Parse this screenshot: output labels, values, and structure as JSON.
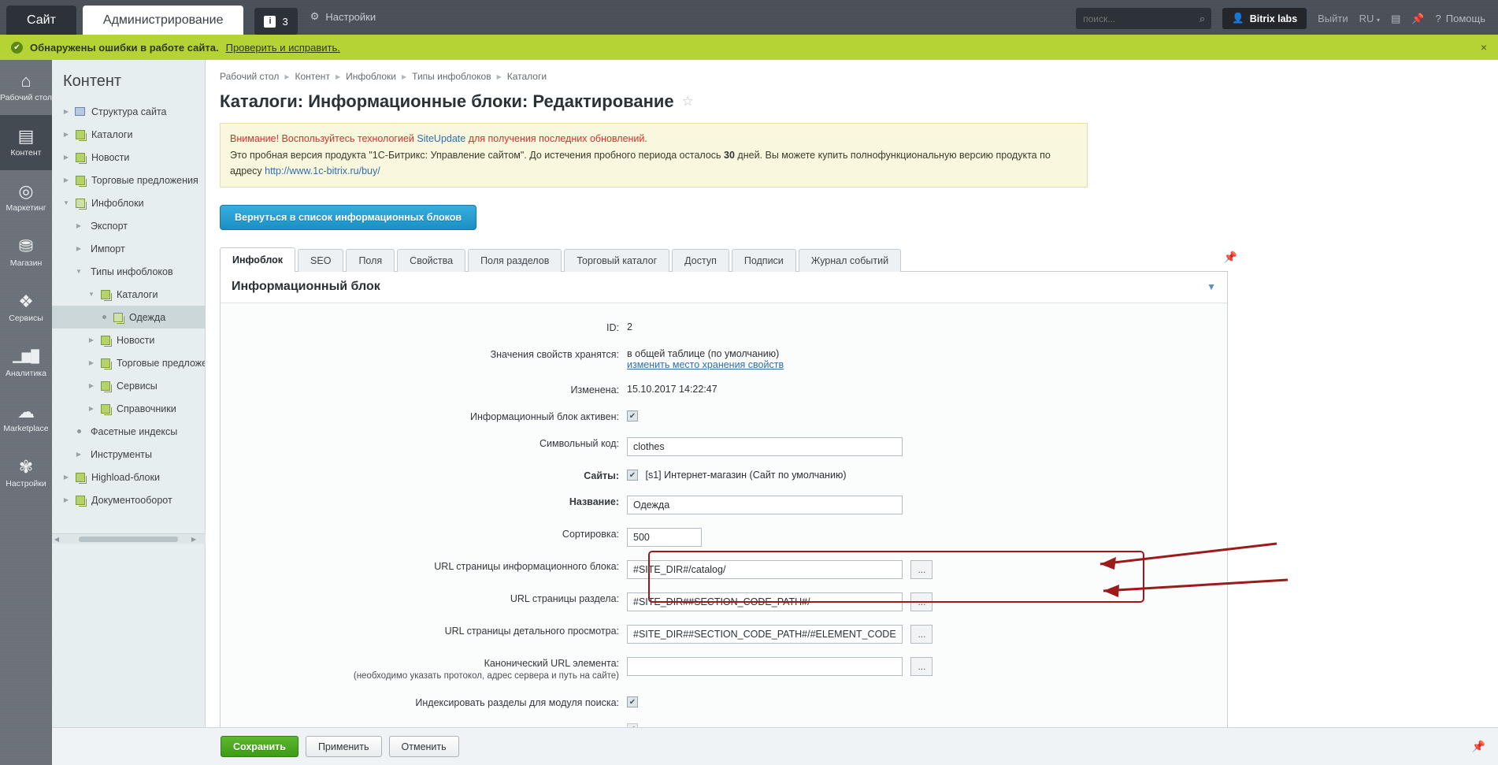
{
  "topbar": {
    "tab_site": "Сайт",
    "tab_admin": "Администрирование",
    "badge_count": "3",
    "badge_icon": "info-icon",
    "settings": "Настройки",
    "search_placeholder": "поиск...",
    "user": "Bitrix labs",
    "logout": "Выйти",
    "lang": "RU",
    "help": "Помощь"
  },
  "alert": {
    "text": "Обнаружены ошибки в работе сайта.",
    "link": "Проверить и исправить.",
    "close": "×"
  },
  "rail": [
    {
      "label": "Рабочий стол",
      "icon": "home-icon",
      "glyph": "⌂",
      "active": false
    },
    {
      "label": "Контент",
      "icon": "content-icon",
      "glyph": "▤",
      "active": true
    },
    {
      "label": "Маркетинг",
      "icon": "target-icon",
      "glyph": "◎",
      "active": false
    },
    {
      "label": "Магазин",
      "icon": "basket-icon",
      "glyph": "⛁",
      "active": false
    },
    {
      "label": "Сервисы",
      "icon": "layers-icon",
      "glyph": "❖",
      "active": false
    },
    {
      "label": "Аналитика",
      "icon": "bar-chart-icon",
      "glyph": "▁▄█",
      "active": false
    },
    {
      "label": "Marketplace",
      "icon": "cloud-download-icon",
      "glyph": "☁",
      "active": false
    },
    {
      "label": "Настройки",
      "icon": "gear-icon",
      "glyph": "✿",
      "active": false
    }
  ],
  "tree": {
    "title": "Контент",
    "items": [
      {
        "label": "Структура сайта",
        "indent": 0,
        "twisty": "▶",
        "icon": "site-structure-icon",
        "selected": false
      },
      {
        "label": "Каталоги",
        "indent": 0,
        "twisty": "▶",
        "icon": "doc-icon",
        "selected": false
      },
      {
        "label": "Новости",
        "indent": 0,
        "twisty": "▶",
        "icon": "doc-icon",
        "selected": false
      },
      {
        "label": "Торговые предложения",
        "indent": 0,
        "twisty": "▶",
        "icon": "doc-icon",
        "selected": false
      },
      {
        "label": "Инфоблоки",
        "indent": 0,
        "twisty": "▼",
        "icon": "infoblock-icon",
        "selected": false
      },
      {
        "label": "Экспорт",
        "indent": 1,
        "twisty": "▶",
        "icon": "none",
        "selected": false
      },
      {
        "label": "Импорт",
        "indent": 1,
        "twisty": "▶",
        "icon": "none",
        "selected": false
      },
      {
        "label": "Типы инфоблоков",
        "indent": 1,
        "twisty": "▼",
        "icon": "none",
        "selected": false
      },
      {
        "label": "Каталоги",
        "indent": 2,
        "twisty": "▼",
        "icon": "doc-icon",
        "selected": false
      },
      {
        "label": "Одежда",
        "indent": 3,
        "twisty": "dot",
        "icon": "infoblock-icon",
        "selected": true
      },
      {
        "label": "Новости",
        "indent": 2,
        "twisty": "▶",
        "icon": "doc-icon",
        "selected": false
      },
      {
        "label": "Торговые предложе",
        "indent": 2,
        "twisty": "▶",
        "icon": "doc-icon",
        "selected": false
      },
      {
        "label": "Сервисы",
        "indent": 2,
        "twisty": "▶",
        "icon": "doc-icon",
        "selected": false
      },
      {
        "label": "Справочники",
        "indent": 2,
        "twisty": "▶",
        "icon": "doc-icon",
        "selected": false
      },
      {
        "label": "Фасетные индексы",
        "indent": 1,
        "twisty": "dot",
        "icon": "none",
        "selected": false
      },
      {
        "label": "Инструменты",
        "indent": 1,
        "twisty": "▶",
        "icon": "none",
        "selected": false
      },
      {
        "label": "Highload-блоки",
        "indent": 0,
        "twisty": "▶",
        "icon": "doc-icon",
        "selected": false
      },
      {
        "label": "Документооборот",
        "indent": 0,
        "twisty": "▶",
        "icon": "doc-icon",
        "selected": false
      }
    ]
  },
  "breadcrumbs": [
    "Рабочий стол",
    "Контент",
    "Инфоблоки",
    "Типы инфоблоков",
    "Каталоги"
  ],
  "page": {
    "title": "Каталоги: Информационные блоки: Редактирование",
    "star": "☆"
  },
  "notice": {
    "line1_a": "Внимание! Воспользуйтесь технологией ",
    "line1_link": "SiteUpdate",
    "line1_b": " для получения последних обновлений.",
    "line2_a": "Это пробная версия продукта \"1С-Битрикс: Управление сайтом\". До истечения пробного периода осталось ",
    "line2_days": "30",
    "line2_b": " дней. Вы можете купить полнофункциональную версию продукта по адресу ",
    "line2_link": "http://www.1c-bitrix.ru/buy/"
  },
  "back_button": "Вернуться в список информационных блоков",
  "tabs": [
    {
      "label": "Инфоблок",
      "active": true
    },
    {
      "label": "SEO",
      "active": false
    },
    {
      "label": "Поля",
      "active": false
    },
    {
      "label": "Свойства",
      "active": false
    },
    {
      "label": "Поля разделов",
      "active": false
    },
    {
      "label": "Торговый каталог",
      "active": false
    },
    {
      "label": "Доступ",
      "active": false
    },
    {
      "label": "Подписи",
      "active": false
    },
    {
      "label": "Журнал событий",
      "active": false
    }
  ],
  "panel": {
    "title": "Информационный блок",
    "collapse_icon": "chevron-down-icon"
  },
  "form": {
    "id_label": "ID:",
    "id_value": "2",
    "storage_label": "Значения свойств хранятся:",
    "storage_value": "в общей таблице (по умолчанию)",
    "storage_link": "изменить место хранения свойств",
    "modified_label": "Изменена:",
    "modified_value": "15.10.2017 14:22:47",
    "active_label": "Информационный блок активен:",
    "active_checked": "✔",
    "code_label": "Символьный код:",
    "code_value": "clothes",
    "sites_label": "Сайты:",
    "sites_value": "[s1] Интернет-магазин (Сайт по умолчанию)",
    "sites_checked": "✔",
    "name_label": "Название:",
    "name_value": "Одежда",
    "sort_label": "Сортировка:",
    "sort_value": "500",
    "url_block_label": "URL страницы информационного блока:",
    "url_block_value": "#SITE_DIR#/catalog/",
    "url_section_label": "URL страницы раздела:",
    "url_section_value": "#SITE_DIR##SECTION_CODE_PATH#/",
    "url_detail_label": "URL страницы детального просмотра:",
    "url_detail_value": "#SITE_DIR##SECTION_CODE_PATH#/#ELEMENT_CODE#/",
    "canonical_label": "Канонический URL элемента:",
    "canonical_sub": "(необходимо указать протокол, адрес сервера и путь на сайте)",
    "canonical_value": "",
    "index_sections_label": "Индексировать разделы для модуля поиска:",
    "index_sections_checked": "✔",
    "browse_button": "...",
    "highlight_color": "#9c1a1a"
  },
  "footer": {
    "save": "Сохранить",
    "apply": "Применить",
    "cancel": "Отменить",
    "pin_icon": "pin-icon"
  }
}
